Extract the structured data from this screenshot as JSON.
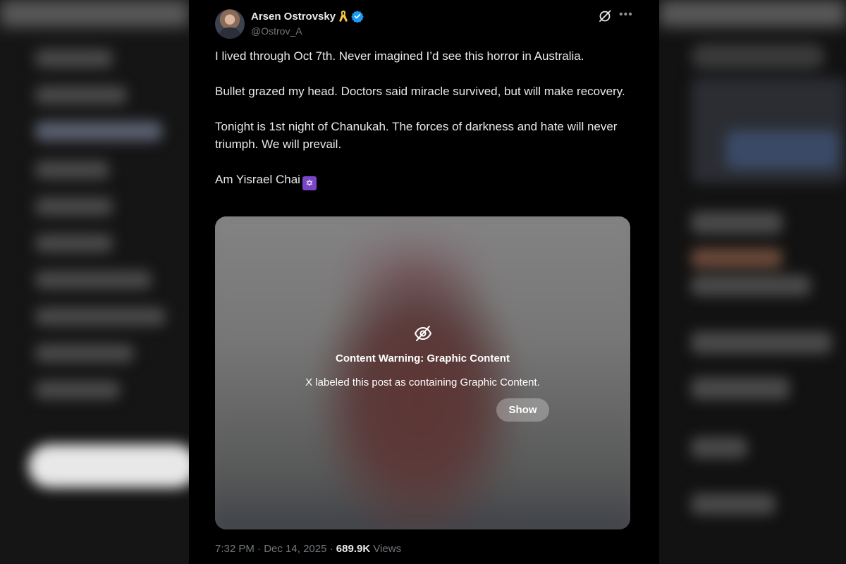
{
  "post": {
    "author_name": "Arsen Ostrovsky",
    "handle": "@Ostrov_A",
    "paragraphs": [
      "I lived through Oct 7th. Never imagined I’d see this horror in Australia.",
      "Bullet grazed my head. Doctors said miracle survived, but will make recovery.",
      "Tonight is 1st night of Chanukah. The forces of darkness and hate will never triumph. We will prevail."
    ],
    "closing_line": "Am Yisrael Chai",
    "closing_emoji": "✡",
    "icons": {
      "ribbon": "yellow-ribbon-icon",
      "verified": "verified-badge-icon",
      "grok": "grok-icon",
      "more": "more-options-icon",
      "warning": "eye-slash-icon"
    },
    "colors": {
      "verified": "#1d9bf0",
      "ribbon": "#f5c542",
      "background": "#000000"
    }
  },
  "media": {
    "warning_title": "Content Warning: Graphic Content",
    "warning_description": "X labeled this post as containing Graphic Content.",
    "show_label": "Show"
  },
  "meta": {
    "time": "7:32 PM",
    "separator": "·",
    "date": "Dec 14, 2025",
    "views_count": "689.9K",
    "views_label": "Views"
  }
}
